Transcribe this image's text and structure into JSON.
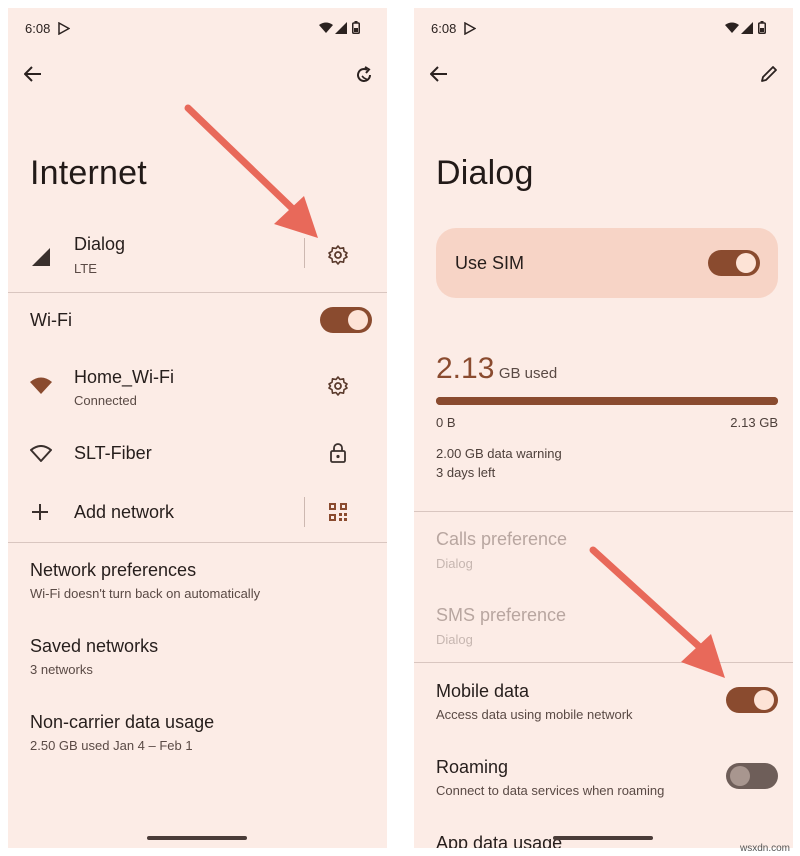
{
  "left": {
    "status": {
      "time": "6:08"
    },
    "title": "Internet",
    "sim": {
      "name": "Dialog",
      "sub": "LTE"
    },
    "wifi": {
      "label": "Wi-Fi",
      "enabled": true
    },
    "networks": [
      {
        "name": "Home_Wi-Fi",
        "sub": "Connected",
        "icon": "wifi-filled-icon",
        "action_icon": "gear-icon"
      },
      {
        "name": "SLT-Fiber",
        "sub": "",
        "icon": "wifi-outline-icon",
        "action_icon": "lock-icon"
      }
    ],
    "add_network": "Add network",
    "prefs": [
      {
        "title": "Network preferences",
        "sub": "Wi-Fi doesn't turn back on automatically"
      },
      {
        "title": "Saved networks",
        "sub": "3 networks"
      },
      {
        "title": "Non-carrier data usage",
        "sub": "2.50 GB used Jan 4 – Feb 1"
      }
    ]
  },
  "right": {
    "status": {
      "time": "6:08"
    },
    "title": "Dialog",
    "use_sim": {
      "label": "Use SIM",
      "enabled": true
    },
    "usage": {
      "amount": "2.13",
      "unit": "GB used",
      "min_label": "0 B",
      "max_label": "2.13 GB",
      "fraction": 1.0,
      "warning": "2.00 GB data warning",
      "days_left": "3 days left"
    },
    "calls": {
      "title": "Calls preference",
      "sub": "Dialog"
    },
    "sms": {
      "title": "SMS preference",
      "sub": "Dialog"
    },
    "mobile_data": {
      "title": "Mobile data",
      "sub": "Access data using mobile network",
      "enabled": true
    },
    "roaming": {
      "title": "Roaming",
      "sub": "Connect to data services when roaming",
      "enabled": false
    },
    "app_data": {
      "title": "App data usage"
    }
  },
  "colors": {
    "background": "#fcece6",
    "accent": "#8a4b2f",
    "arrow": "#e8695a"
  },
  "watermark": "wsxdn.com"
}
